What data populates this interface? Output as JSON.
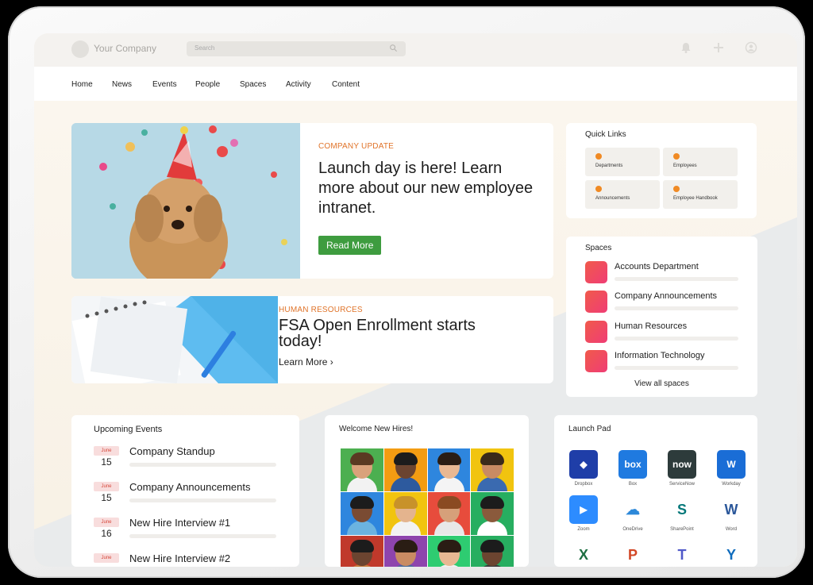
{
  "header": {
    "company": "Your Company",
    "search_placeholder": "Search",
    "icons": [
      "bell-icon",
      "plus-icon",
      "user-icon"
    ]
  },
  "nav": {
    "items": [
      "Home",
      "News",
      "Events",
      "People",
      "Spaces",
      "Activity",
      "Content"
    ]
  },
  "hero": {
    "kicker": "COMPANY UPDATE",
    "title": "Launch day is here! Learn more about our new employee intranet.",
    "button": "Read More"
  },
  "fsa": {
    "kicker": "HUMAN RESOURCES",
    "title": "FSA Open Enrollment starts today!",
    "link": "Learn More"
  },
  "quick_links": {
    "title": "Quick Links",
    "items": [
      "Departments",
      "Employees",
      "Announcements",
      "Employee Handbook"
    ]
  },
  "spaces": {
    "title": "Spaces",
    "items": [
      "Accounts Department",
      "Company Announcements",
      "Human Resources",
      "Information Technology"
    ],
    "view_all": "View all spaces"
  },
  "events": {
    "title": "Upcoming Events",
    "items": [
      {
        "month": "June",
        "day": "15",
        "title": "Company Standup"
      },
      {
        "month": "June",
        "day": "15",
        "title": "Company Announcements"
      },
      {
        "month": "June",
        "day": "16",
        "title": "New Hire Interview #1"
      },
      {
        "month": "June",
        "day": "",
        "title": "New Hire Interview #2"
      }
    ]
  },
  "new_hires": {
    "title": "Welcome New Hires!"
  },
  "launch_pad": {
    "title": "Launch Pad",
    "apps": [
      {
        "label": "Dropbox",
        "glyph": "◆",
        "color": "#1f3ea8"
      },
      {
        "label": "Box",
        "glyph": "box",
        "color": "#1f7ae0"
      },
      {
        "label": "ServiceNow",
        "glyph": "now",
        "color": "#2d3b3b"
      },
      {
        "label": "Workday",
        "glyph": "W",
        "color": "#1a6dd6"
      },
      {
        "label": "Zoom",
        "glyph": "▶",
        "color": "#2d8cff"
      },
      {
        "label": "OneDrive",
        "glyph": "☁",
        "color": "#ffffff"
      },
      {
        "label": "SharePoint",
        "glyph": "S",
        "color": "#ffffff"
      },
      {
        "label": "Word",
        "glyph": "W",
        "color": "#ffffff"
      },
      {
        "label": "",
        "glyph": "X",
        "color": "#ffffff"
      },
      {
        "label": "",
        "glyph": "P",
        "color": "#ffffff"
      },
      {
        "label": "",
        "glyph": "T",
        "color": "#ffffff"
      },
      {
        "label": "",
        "glyph": "Y",
        "color": "#ffffff"
      }
    ]
  }
}
